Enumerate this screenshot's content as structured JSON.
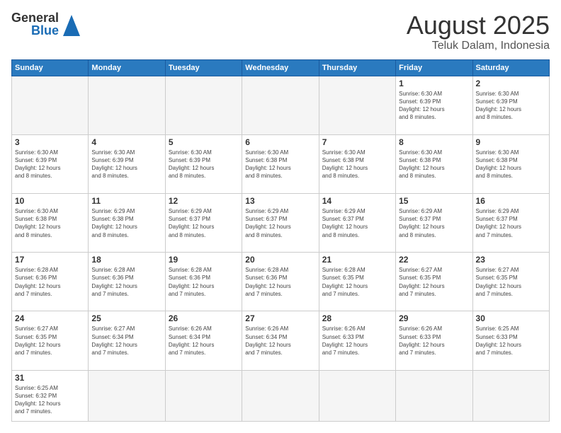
{
  "header": {
    "logo": {
      "general": "General",
      "blue": "Blue"
    },
    "month": "August 2025",
    "location": "Teluk Dalam, Indonesia"
  },
  "weekdays": [
    "Sunday",
    "Monday",
    "Tuesday",
    "Wednesday",
    "Thursday",
    "Friday",
    "Saturday"
  ],
  "weeks": [
    [
      {
        "day": "",
        "info": "",
        "empty": true
      },
      {
        "day": "",
        "info": "",
        "empty": true
      },
      {
        "day": "",
        "info": "",
        "empty": true
      },
      {
        "day": "",
        "info": "",
        "empty": true
      },
      {
        "day": "",
        "info": "",
        "empty": true
      },
      {
        "day": "1",
        "info": "Sunrise: 6:30 AM\nSunset: 6:39 PM\nDaylight: 12 hours\nand 8 minutes."
      },
      {
        "day": "2",
        "info": "Sunrise: 6:30 AM\nSunset: 6:39 PM\nDaylight: 12 hours\nand 8 minutes."
      }
    ],
    [
      {
        "day": "3",
        "info": "Sunrise: 6:30 AM\nSunset: 6:39 PM\nDaylight: 12 hours\nand 8 minutes."
      },
      {
        "day": "4",
        "info": "Sunrise: 6:30 AM\nSunset: 6:39 PM\nDaylight: 12 hours\nand 8 minutes."
      },
      {
        "day": "5",
        "info": "Sunrise: 6:30 AM\nSunset: 6:39 PM\nDaylight: 12 hours\nand 8 minutes."
      },
      {
        "day": "6",
        "info": "Sunrise: 6:30 AM\nSunset: 6:38 PM\nDaylight: 12 hours\nand 8 minutes."
      },
      {
        "day": "7",
        "info": "Sunrise: 6:30 AM\nSunset: 6:38 PM\nDaylight: 12 hours\nand 8 minutes."
      },
      {
        "day": "8",
        "info": "Sunrise: 6:30 AM\nSunset: 6:38 PM\nDaylight: 12 hours\nand 8 minutes."
      },
      {
        "day": "9",
        "info": "Sunrise: 6:30 AM\nSunset: 6:38 PM\nDaylight: 12 hours\nand 8 minutes."
      }
    ],
    [
      {
        "day": "10",
        "info": "Sunrise: 6:30 AM\nSunset: 6:38 PM\nDaylight: 12 hours\nand 8 minutes."
      },
      {
        "day": "11",
        "info": "Sunrise: 6:29 AM\nSunset: 6:38 PM\nDaylight: 12 hours\nand 8 minutes."
      },
      {
        "day": "12",
        "info": "Sunrise: 6:29 AM\nSunset: 6:37 PM\nDaylight: 12 hours\nand 8 minutes."
      },
      {
        "day": "13",
        "info": "Sunrise: 6:29 AM\nSunset: 6:37 PM\nDaylight: 12 hours\nand 8 minutes."
      },
      {
        "day": "14",
        "info": "Sunrise: 6:29 AM\nSunset: 6:37 PM\nDaylight: 12 hours\nand 8 minutes."
      },
      {
        "day": "15",
        "info": "Sunrise: 6:29 AM\nSunset: 6:37 PM\nDaylight: 12 hours\nand 8 minutes."
      },
      {
        "day": "16",
        "info": "Sunrise: 6:29 AM\nSunset: 6:37 PM\nDaylight: 12 hours\nand 7 minutes."
      }
    ],
    [
      {
        "day": "17",
        "info": "Sunrise: 6:28 AM\nSunset: 6:36 PM\nDaylight: 12 hours\nand 7 minutes."
      },
      {
        "day": "18",
        "info": "Sunrise: 6:28 AM\nSunset: 6:36 PM\nDaylight: 12 hours\nand 7 minutes."
      },
      {
        "day": "19",
        "info": "Sunrise: 6:28 AM\nSunset: 6:36 PM\nDaylight: 12 hours\nand 7 minutes."
      },
      {
        "day": "20",
        "info": "Sunrise: 6:28 AM\nSunset: 6:36 PM\nDaylight: 12 hours\nand 7 minutes."
      },
      {
        "day": "21",
        "info": "Sunrise: 6:28 AM\nSunset: 6:35 PM\nDaylight: 12 hours\nand 7 minutes."
      },
      {
        "day": "22",
        "info": "Sunrise: 6:27 AM\nSunset: 6:35 PM\nDaylight: 12 hours\nand 7 minutes."
      },
      {
        "day": "23",
        "info": "Sunrise: 6:27 AM\nSunset: 6:35 PM\nDaylight: 12 hours\nand 7 minutes."
      }
    ],
    [
      {
        "day": "24",
        "info": "Sunrise: 6:27 AM\nSunset: 6:35 PM\nDaylight: 12 hours\nand 7 minutes."
      },
      {
        "day": "25",
        "info": "Sunrise: 6:27 AM\nSunset: 6:34 PM\nDaylight: 12 hours\nand 7 minutes."
      },
      {
        "day": "26",
        "info": "Sunrise: 6:26 AM\nSunset: 6:34 PM\nDaylight: 12 hours\nand 7 minutes."
      },
      {
        "day": "27",
        "info": "Sunrise: 6:26 AM\nSunset: 6:34 PM\nDaylight: 12 hours\nand 7 minutes."
      },
      {
        "day": "28",
        "info": "Sunrise: 6:26 AM\nSunset: 6:33 PM\nDaylight: 12 hours\nand 7 minutes."
      },
      {
        "day": "29",
        "info": "Sunrise: 6:26 AM\nSunset: 6:33 PM\nDaylight: 12 hours\nand 7 minutes."
      },
      {
        "day": "30",
        "info": "Sunrise: 6:25 AM\nSunset: 6:33 PM\nDaylight: 12 hours\nand 7 minutes."
      }
    ],
    [
      {
        "day": "31",
        "info": "Sunrise: 6:25 AM\nSunset: 6:32 PM\nDaylight: 12 hours\nand 7 minutes."
      },
      {
        "day": "",
        "info": "",
        "empty": true
      },
      {
        "day": "",
        "info": "",
        "empty": true
      },
      {
        "day": "",
        "info": "",
        "empty": true
      },
      {
        "day": "",
        "info": "",
        "empty": true
      },
      {
        "day": "",
        "info": "",
        "empty": true
      },
      {
        "day": "",
        "info": "",
        "empty": true
      }
    ]
  ]
}
